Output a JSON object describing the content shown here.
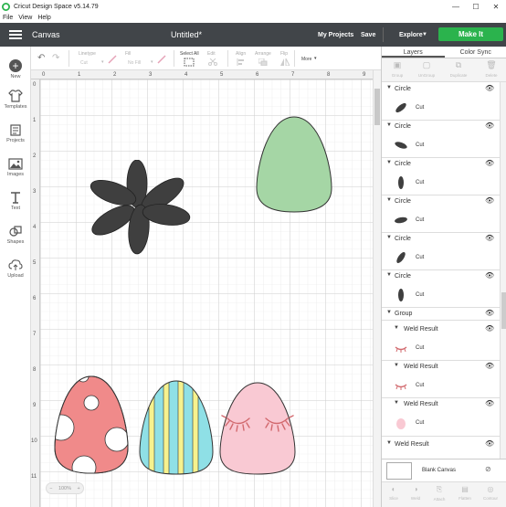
{
  "window": {
    "title": "Cricut Design Space  v5.14.79",
    "controls": {
      "minimize": "—",
      "maximize": "☐",
      "close": "✕"
    }
  },
  "menu": [
    "File",
    "View",
    "Help"
  ],
  "appbar": {
    "section": "Canvas",
    "document_title": "Untitled*",
    "my_projects": "My Projects",
    "save": "Save",
    "explore": "Explore",
    "make_it": "Make It",
    "accent_color": "#2bb34d"
  },
  "left_nav": [
    {
      "label": "New",
      "icon": "plus-icon"
    },
    {
      "label": "Templates",
      "icon": "shirt-icon"
    },
    {
      "label": "Projects",
      "icon": "projects-icon"
    },
    {
      "label": "Images",
      "icon": "image-icon"
    },
    {
      "label": "Text",
      "icon": "text-icon"
    },
    {
      "label": "Shapes",
      "icon": "shapes-icon"
    },
    {
      "label": "Upload",
      "icon": "upload-icon"
    }
  ],
  "toolbar": {
    "linetype_label": "Linetype",
    "linetype_value": "Cut",
    "fill_label": "Fill",
    "fill_value": "No Fill",
    "select_all": "Select All",
    "edit": "Edit",
    "align": "Align",
    "arrange": "Arrange",
    "flip": "Flip",
    "more": "More"
  },
  "rulers": {
    "top": [
      "0",
      "1",
      "2",
      "3",
      "4",
      "5",
      "6",
      "7",
      "8",
      "9"
    ],
    "left": [
      "0",
      "1",
      "2",
      "3",
      "4",
      "5",
      "6",
      "7",
      "8",
      "9",
      "10",
      "11"
    ]
  },
  "zoom": {
    "minus": "−",
    "value": "100%",
    "plus": "+"
  },
  "right_panel": {
    "tabs": [
      "Layers",
      "Color Sync"
    ],
    "actions": [
      "Group",
      "UnGroup",
      "Duplicate",
      "Delete"
    ],
    "layers": [
      {
        "name": "Circle",
        "operation": "Cut"
      },
      {
        "name": "Circle",
        "operation": "Cut"
      },
      {
        "name": "Circle",
        "operation": "Cut"
      },
      {
        "name": "Circle",
        "operation": "Cut"
      },
      {
        "name": "Circle",
        "operation": "Cut"
      },
      {
        "name": "Circle",
        "operation": "Cut"
      }
    ],
    "group_label": "Group",
    "weld_results": [
      {
        "name": "Weld Result",
        "operation": "Cut"
      },
      {
        "name": "Weld Result",
        "operation": "Cut"
      },
      {
        "name": "Weld Result",
        "operation": "Cut"
      }
    ],
    "trailing_weld": "Weld Result",
    "blank_canvas": "Blank Canvas",
    "bottom_actions": [
      "Slice",
      "Weld",
      "Attach",
      "Flatten",
      "Contour"
    ]
  },
  "colors": {
    "flower": "#3f3f3f",
    "green_egg": "#a5d6a5",
    "spotted_egg": "#f08a8a",
    "stripe_blue": "#8fe0e6",
    "stripe_yellow": "#f6f28e",
    "pink_egg": "#f9c9d3",
    "lash": "#d2696e"
  }
}
